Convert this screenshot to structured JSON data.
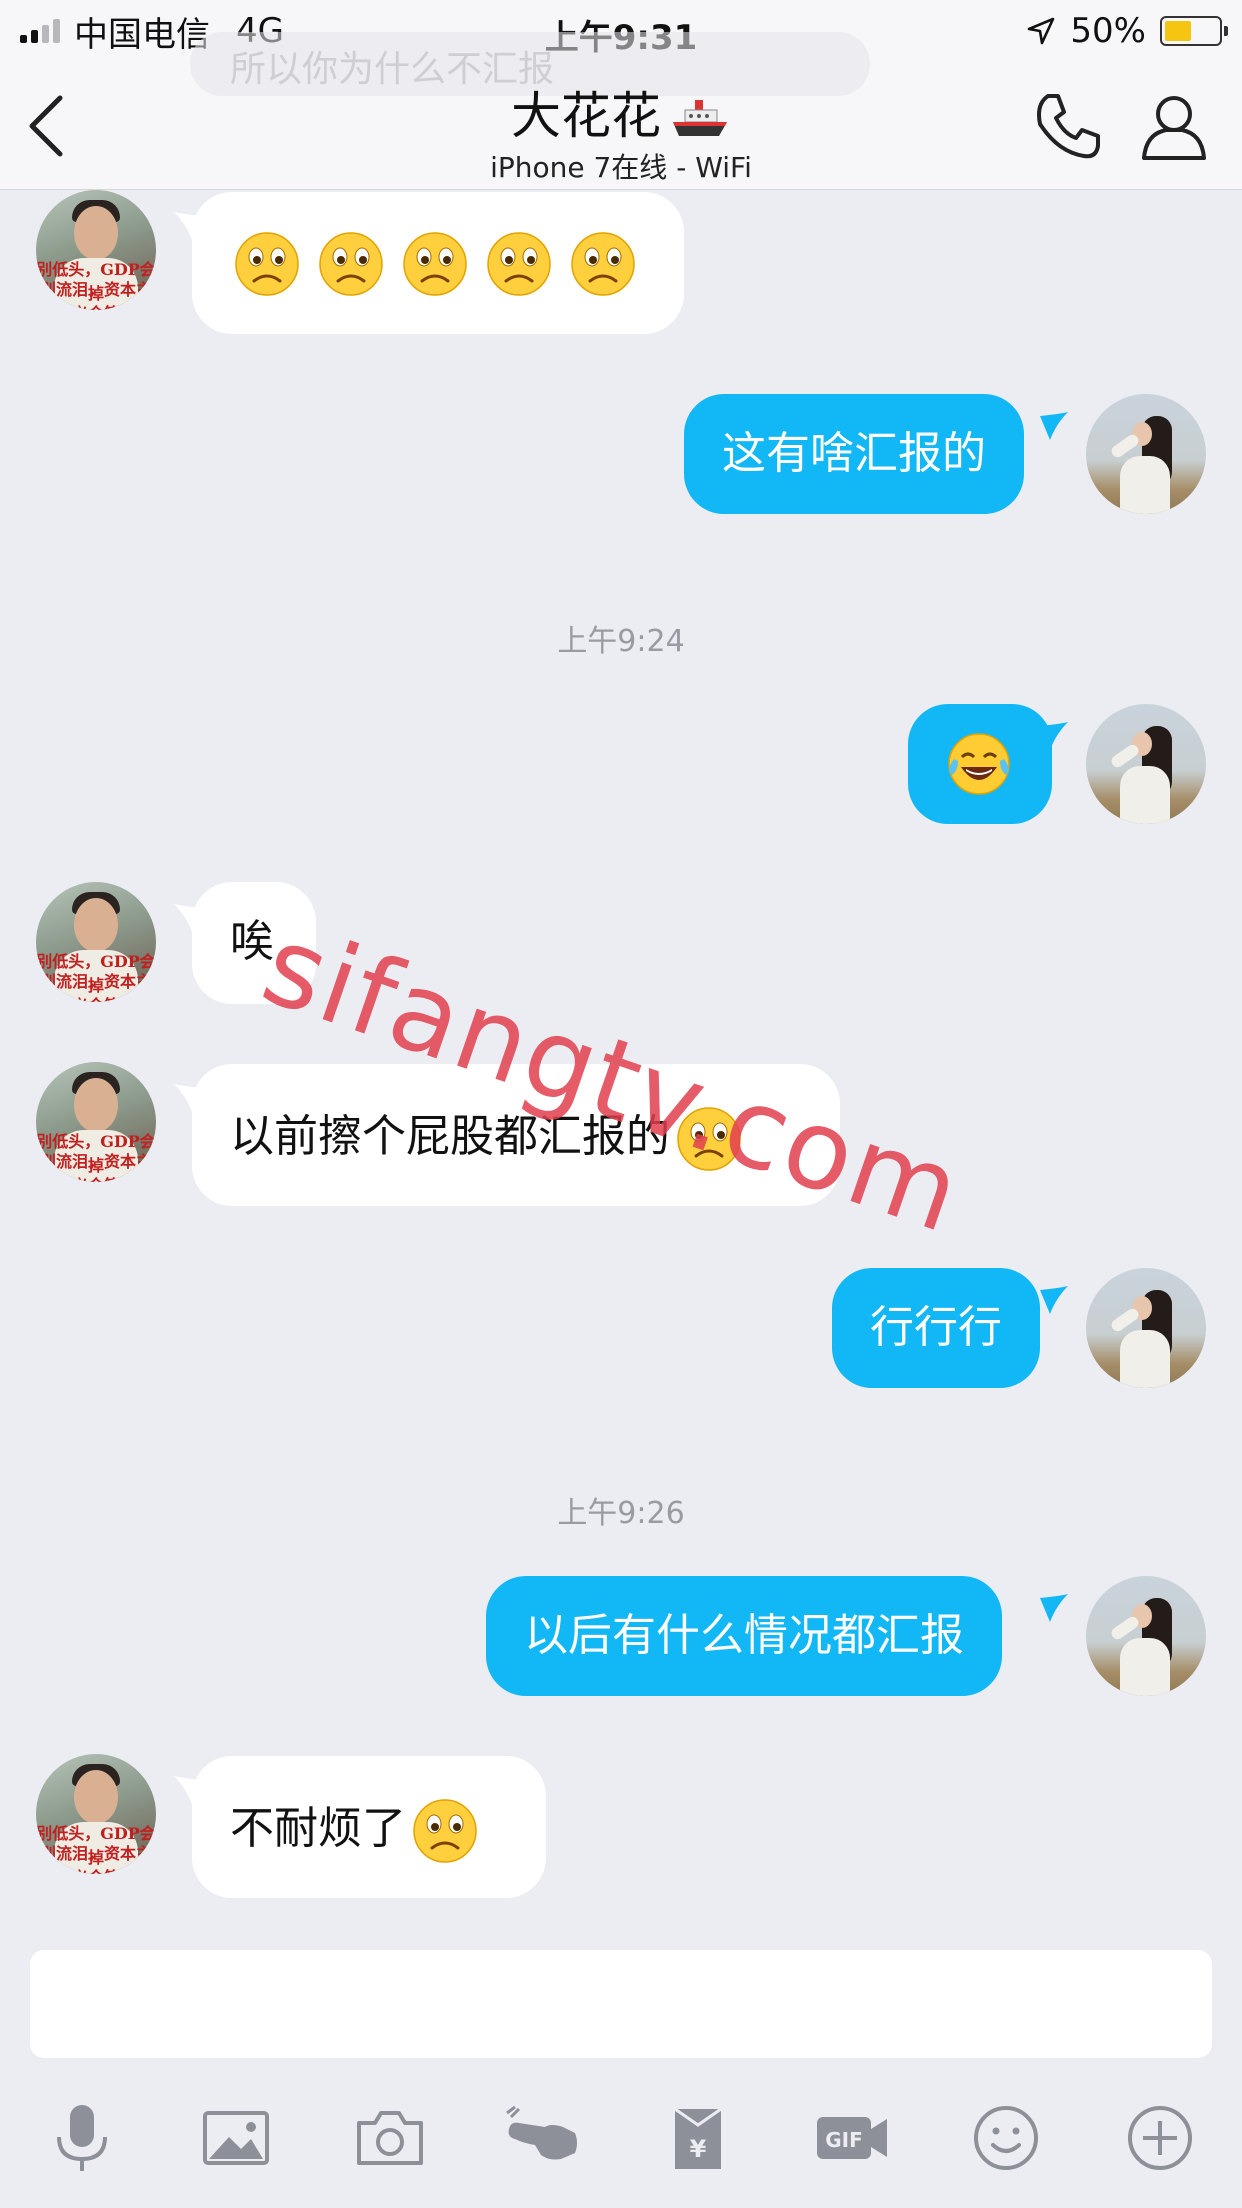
{
  "status_bar": {
    "carrier": "中国电信",
    "network": "4G",
    "time": "上午9:31",
    "battery_percent": "50%",
    "battery_level": 0.5,
    "battery_color": "#f6c511",
    "signal_bars": 4,
    "signal_bars_filled": 2
  },
  "header": {
    "contact_name": "大花花",
    "name_icon": "ship-icon",
    "subtitle": "iPhone 7在线 - WiFi",
    "preview_ghost": "所以你为什么不汇报",
    "icons": [
      "back-icon",
      "phone-icon",
      "profile-icon"
    ]
  },
  "messages": {
    "m1": {
      "side": "incoming",
      "emoji_name": "frowning-face",
      "emoji_count": 5
    },
    "m2": {
      "side": "outgoing",
      "text": "这有啥汇报的"
    },
    "ts1": "上午9:24",
    "m3": {
      "side": "outgoing",
      "emoji_name": "tears-of-joy"
    },
    "m4": {
      "side": "incoming",
      "text": "唉"
    },
    "m5": {
      "side": "incoming",
      "text": "以前擦个屁股都汇报的",
      "emoji_name": "frowning-face"
    },
    "m6": {
      "side": "outgoing",
      "text": "行行行"
    },
    "ts2": "上午9:26",
    "m7": {
      "side": "outgoing",
      "text": "以后有什么情况都汇报"
    },
    "m8": {
      "side": "incoming",
      "text": "不耐烦了",
      "emoji_name": "frowning-face"
    }
  },
  "avatar_text": {
    "line1": "别低头，GDP会掉",
    "line2": "别流泪，资本主义会笑"
  },
  "watermark": "sifangtv.com",
  "toolbar": [
    "microphone-icon",
    "image-icon",
    "camera-icon",
    "poke-icon",
    "red-envelope-icon",
    "gif-icon",
    "emoji-icon",
    "plus-icon"
  ],
  "colors": {
    "accent_blue": "#12b7f5",
    "background": "#ecedf2",
    "watermark": "#e23e4d"
  }
}
